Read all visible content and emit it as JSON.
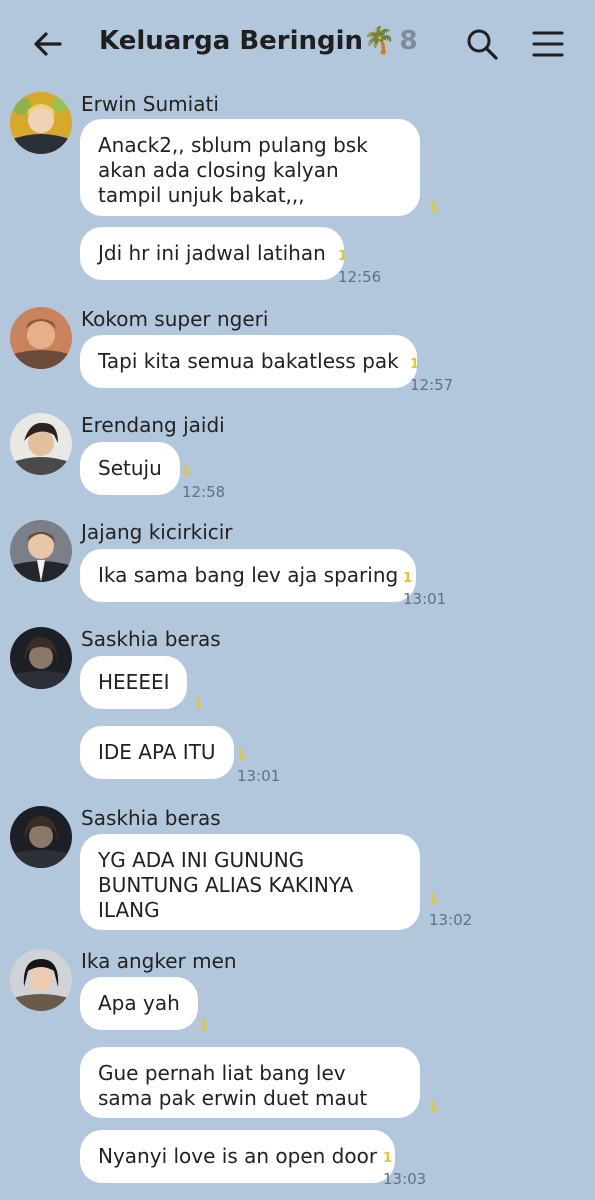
{
  "header": {
    "title": "Keluarga Beringin🌴",
    "member_count": "8",
    "icons": {
      "back": "arrow-left-icon",
      "search": "search-icon",
      "menu": "hamburger-menu-icon"
    }
  },
  "colors": {
    "background": "#b3c7dc",
    "bubble": "#ffffff",
    "read_count": "#e5c62d",
    "time": "#5f7285"
  },
  "messages": [
    {
      "sender": "Erwin Sumiati",
      "text": "Anack2,, sblum pulang bsk akan ada closing kalyan tampil unjuk bakat,,,",
      "read": "1",
      "time": ""
    },
    {
      "sender": "",
      "text": "Jdi hr ini jadwal latihan",
      "read": "1",
      "time": "12:56"
    },
    {
      "sender": "Kokom super ngeri",
      "text": "Tapi kita semua bakatless pak",
      "read": "1",
      "time": "12:57"
    },
    {
      "sender": "Erendang jaidi",
      "text": "Setuju",
      "read": "1",
      "time": "12:58"
    },
    {
      "sender": "Jajang kicirkicir",
      "text": "Ika sama bang lev aja sparing",
      "read": "1",
      "time": "13:01"
    },
    {
      "sender": "Saskhia beras",
      "text": "HEEEEI",
      "read": "1",
      "time": ""
    },
    {
      "sender": "",
      "text": "IDE APA ITU",
      "read": "1",
      "time": "13:01"
    },
    {
      "sender": "Saskhia beras",
      "text": "YG ADA INI GUNUNG BUNTUNG ALIAS KAKINYA ILANG",
      "read": "1",
      "time": "13:02"
    },
    {
      "sender": "Ika angker men",
      "text": "Apa yah",
      "read": "1",
      "time": ""
    },
    {
      "sender": "",
      "text": "Gue pernah liat bang lev sama pak erwin duet maut",
      "read": "1",
      "time": ""
    },
    {
      "sender": "",
      "text": "Nyanyi love is an open door",
      "read": "1",
      "time": "13:03"
    }
  ]
}
